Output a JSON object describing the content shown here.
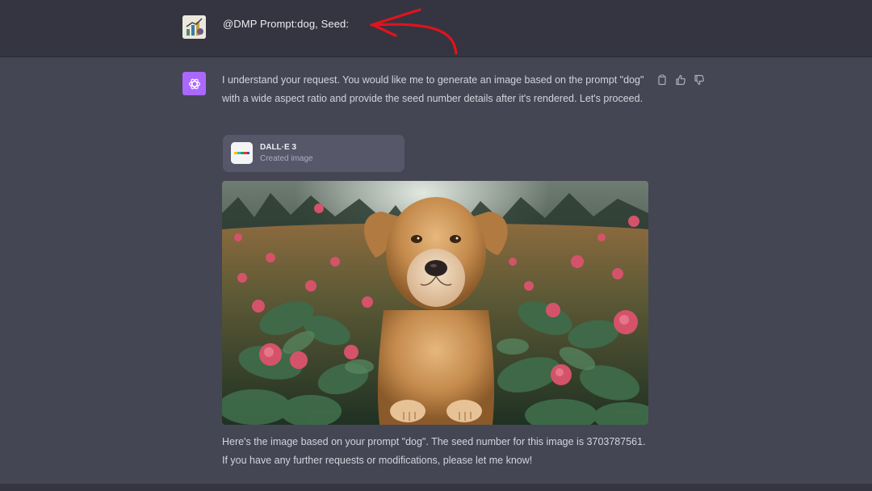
{
  "user_message": {
    "avatar_icon": "chart-avatar-icon",
    "text": "@DMP Prompt:dog, Seed:",
    "annotation_icon": "red-arrow-icon"
  },
  "assistant_message": {
    "avatar_icon": "openai-logo-icon",
    "intro": "I understand your request. You would like me to generate an image based on the prompt \"dog\" with a wide aspect ratio and provide the seed number details after it's rendered. Let's proceed.",
    "tool_card": {
      "title": "DALL·E 3",
      "subtitle": "Created image",
      "icon": "dalle-icon"
    },
    "image_subject": "golden-retriever-dog-in-flower-field",
    "outro": "Here's the image based on your prompt \"dog\". The seed number for this image is 3703787561. If you have any further requests or modifications, please let me know!",
    "actions": [
      {
        "name": "copy-icon"
      },
      {
        "name": "thumbs-up-icon"
      },
      {
        "name": "thumbs-down-icon"
      }
    ]
  },
  "colors": {
    "user_bg": "#343541",
    "assistant_bg": "#444654",
    "gpt_avatar": "#ab68ff",
    "annotation_arrow": "#e3121b"
  }
}
